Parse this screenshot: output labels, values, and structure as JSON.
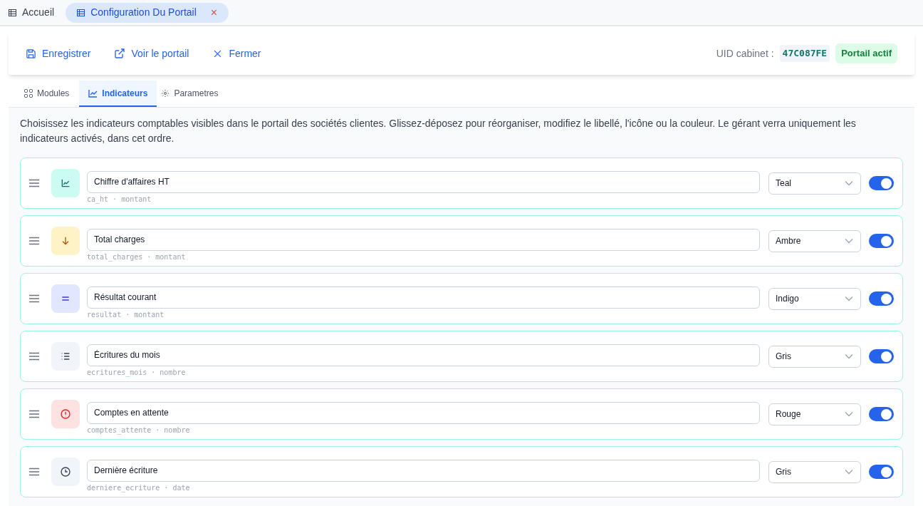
{
  "tabs": [
    {
      "label": "Accueil",
      "selected": false
    },
    {
      "label": "Configuration Du Portail",
      "selected": true,
      "close": "×"
    }
  ],
  "toolbar": {
    "actions": [
      {
        "kind": "save",
        "label": "Enregistrer"
      },
      {
        "kind": "external",
        "label": "Voir le portail"
      },
      {
        "kind": "close",
        "label": "Fermer"
      }
    ],
    "uid_label": "UID cabinet :",
    "uid": "47C087FE",
    "status": "Portail actif"
  },
  "section_tabs": [
    {
      "kind": "grid",
      "label": "Modules",
      "selected": false
    },
    {
      "kind": "chart",
      "label": "Indicateurs",
      "selected": true
    },
    {
      "kind": "gear",
      "label": "Parametres",
      "selected": false
    }
  ],
  "description": "Choisissez les indicateurs comptables visibles dans le portail des sociétés clientes. Glissez-déposez pour réorganiser, modifiez le libellé, l'icône ou la couleur. Le gérant verra uniquement les indicateurs activés, dans cet ordre.",
  "indicators": [
    {
      "kind": "chart",
      "color": "#ccfbf1",
      "label": "Chiffre d'affaires HT",
      "key": "ca_ht",
      "separator": "·",
      "type": "montant",
      "color_name": "Teal",
      "enabled": true
    },
    {
      "kind": "arrow",
      "color": "#fef3c7",
      "label": "Total charges",
      "key": "total_charges",
      "separator": "·",
      "type": "montant",
      "color_name": "Ambre",
      "enabled": true
    },
    {
      "kind": "equals",
      "color": "#e0e7ff",
      "label": "Résultat courant",
      "key": "resultat",
      "separator": "·",
      "type": "montant",
      "color_name": "Indigo",
      "enabled": true
    },
    {
      "kind": "list",
      "color": "#f1f5f9",
      "label": "Écritures du mois",
      "key": "ecritures_mois",
      "separator": "·",
      "type": "nombre",
      "color_name": "Gris",
      "enabled": true
    },
    {
      "kind": "alert",
      "color": "#fee2e2",
      "label": "Comptes en attente",
      "key": "comptes_attente",
      "separator": "·",
      "type": "nombre",
      "color_name": "Rouge",
      "enabled": true
    },
    {
      "kind": "clock",
      "color": "#f1f5f9",
      "label": "Dernière écriture",
      "key": "derniere_ecriture",
      "separator": "·",
      "type": "date",
      "color_name": "Gris",
      "enabled": true
    }
  ]
}
